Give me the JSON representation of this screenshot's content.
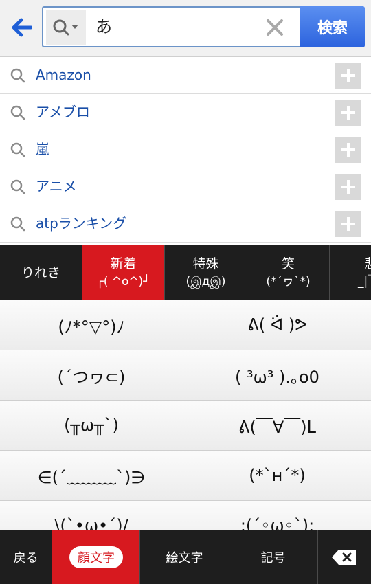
{
  "search": {
    "query": "あ",
    "button_label": "検索"
  },
  "suggestions": [
    {
      "text": "Amazon"
    },
    {
      "text": "アメブロ"
    },
    {
      "text": "嵐"
    },
    {
      "text": "アニメ"
    },
    {
      "text": "atpランキング"
    }
  ],
  "categories": [
    {
      "label": "りれき",
      "sub": ""
    },
    {
      "label": "新着",
      "sub": "┌( ^o^)┘"
    },
    {
      "label": "特殊",
      "sub": "(இдஇ)"
    },
    {
      "label": "笑",
      "sub": "(*´ヮ`*)"
    },
    {
      "label": "悲",
      "sub": "_|￣|"
    }
  ],
  "emoticons": {
    "left": [
      "(ﾉ*°▽°)ﾉ",
      "(´つヮ⊂)",
      "(╥ω╥`)",
      "∈(´﹏﹏﹏`)∋",
      "\\(`•ω•´)/"
    ],
    "right": [
      "ᕕ( ᐛ )ᕗ",
      "( ³ω³ ).｡o0",
      "ᕕ(￣∀￣)ᒪ",
      "(*`ʜ´*)",
      ":(´◦ω◦`):"
    ]
  },
  "bottom_bar": {
    "back": "戻る",
    "kaomoji": "顔文字",
    "emoji": "絵文字",
    "symbols": "記号"
  },
  "colors": {
    "accent_red": "#d7191f",
    "search_blue": "#2c63de",
    "link_blue": "#1a4fa8"
  }
}
